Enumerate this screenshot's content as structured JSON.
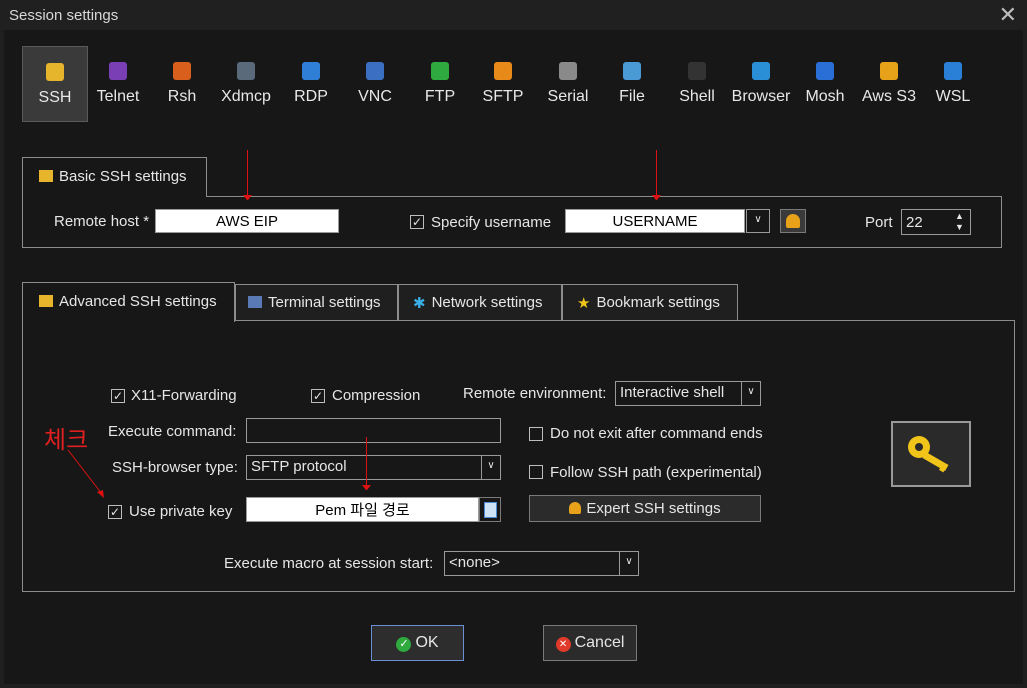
{
  "window": {
    "title": "Session settings"
  },
  "protocols": [
    {
      "label": "SSH",
      "icon": "ssh-icon",
      "color": "#e7b52b"
    },
    {
      "label": "Telnet",
      "icon": "telnet-icon",
      "color": "#7b3fb5"
    },
    {
      "label": "Rsh",
      "icon": "rsh-icon",
      "color": "#d85f1c"
    },
    {
      "label": "Xdmcp",
      "icon": "xdmcp-icon",
      "color": "#5a6a7a"
    },
    {
      "label": "RDP",
      "icon": "rdp-icon",
      "color": "#2f7fd6"
    },
    {
      "label": "VNC",
      "icon": "vnc-icon",
      "color": "#3a6fc2"
    },
    {
      "label": "FTP",
      "icon": "ftp-icon",
      "color": "#2faa3f"
    },
    {
      "label": "SFTP",
      "icon": "sftp-icon",
      "color": "#e88a1a"
    },
    {
      "label": "Serial",
      "icon": "serial-icon",
      "color": "#8a8a8a"
    },
    {
      "label": "File",
      "icon": "file-icon",
      "color": "#4a9ad6"
    },
    {
      "label": "Shell",
      "icon": "shell-icon",
      "color": "#333333"
    },
    {
      "label": "Browser",
      "icon": "browser-icon",
      "color": "#2a8fd6"
    },
    {
      "label": "Mosh",
      "icon": "mosh-icon",
      "color": "#2a6fd6"
    },
    {
      "label": "Aws S3",
      "icon": "aws-s3-icon",
      "color": "#e8a21a"
    },
    {
      "label": "WSL",
      "icon": "wsl-icon",
      "color": "#2a7fd6"
    }
  ],
  "basic": {
    "tab_label": "Basic SSH settings",
    "remote_host_label": "Remote host *",
    "remote_host_value": "AWS EIP",
    "specify_username_label": "Specify username",
    "specify_username_checked": "✓",
    "username_value": "USERNAME",
    "port_label": "Port",
    "port_value": "22"
  },
  "tabs": [
    "Advanced SSH settings",
    "Terminal settings",
    "Network settings",
    "Bookmark settings"
  ],
  "advanced": {
    "x11_label": "X11-Forwarding",
    "x11_checked": "✓",
    "compression_label": "Compression",
    "compression_checked": "✓",
    "remote_env_label": "Remote environment:",
    "remote_env_value": "Interactive shell",
    "execute_command_label": "Execute command:",
    "execute_command_value": "",
    "do_not_exit_label": "Do not exit after command ends",
    "ssh_browser_label": "SSH-browser type:",
    "ssh_browser_value": "SFTP protocol",
    "follow_ssh_label": "Follow SSH path (experimental)",
    "use_private_key_label": "Use private key",
    "use_private_key_checked": "✓",
    "private_key_value": "Pem 파일 경로",
    "expert_button": "Expert SSH settings",
    "macro_label": "Execute macro at session start:",
    "macro_value": "<none>"
  },
  "annotation": {
    "check_text": "체크"
  },
  "buttons": {
    "ok": "OK",
    "cancel": "Cancel"
  }
}
